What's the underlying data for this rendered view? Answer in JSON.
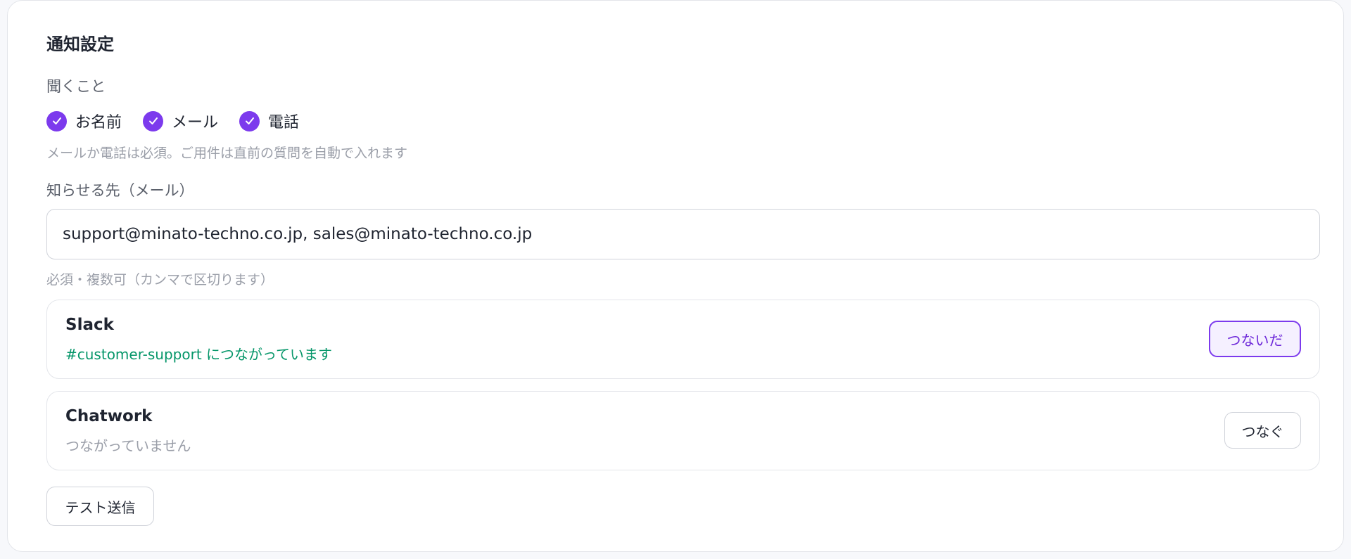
{
  "section": {
    "title": "通知設定"
  },
  "ask": {
    "label": "聞くこと",
    "options": [
      {
        "label": "お名前",
        "checked": true
      },
      {
        "label": "メール",
        "checked": true
      },
      {
        "label": "電話",
        "checked": true
      }
    ],
    "hint": "メールか電話は必須。ご用件は直前の質問を自動で入れます"
  },
  "notify": {
    "label": "知らせる先（メール）",
    "value": "support@minato-techno.co.jp, sales@minato-techno.co.jp",
    "hint": "必須・複数可（カンマで区切ります）"
  },
  "integrations": [
    {
      "name": "Slack",
      "status": "#customer-support につながっています",
      "status_color": "#059669",
      "button_label": "つないだ",
      "connected": true
    },
    {
      "name": "Chatwork",
      "status": "つながっていません",
      "status_color": "#9a9ea8",
      "button_label": "つなぐ",
      "connected": false
    }
  ],
  "test_button_label": "テスト送信",
  "colors": {
    "accent": "#7c3aed",
    "connected_text": "#059669"
  }
}
